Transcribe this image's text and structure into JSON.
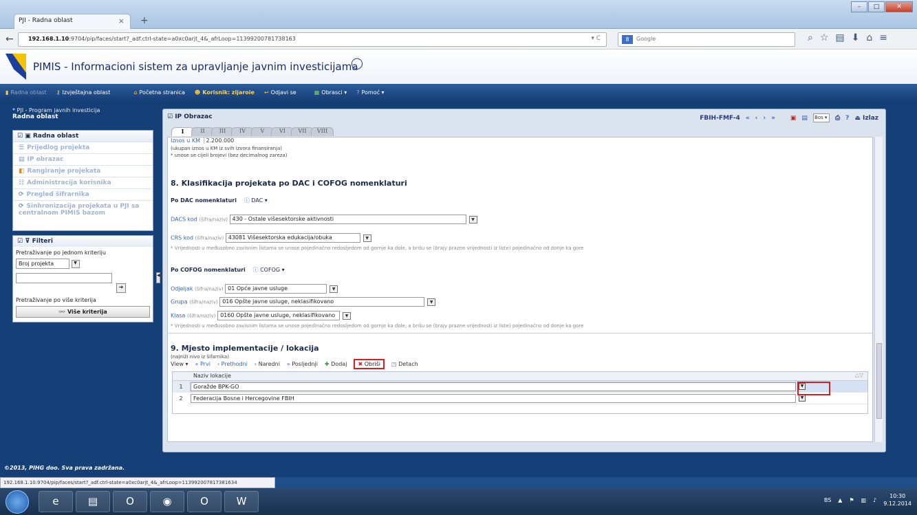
{
  "browser": {
    "tab_title": "PJI - Radna oblast",
    "url_host": "192.168.1.10",
    "url_rest": ":9704/pip/faces/start?_adf.ctrl-state=a0xc0arjt_4&_afrLoop=113992007817381​63",
    "search_placeholder": "Google",
    "search_engine_badge": "8"
  },
  "app": {
    "title": "PIMIS - Informacioni sistem za upravljanje javnim investicijama"
  },
  "menubar": {
    "radna_oblast": "Radna oblast",
    "izvjestajna": "Izvještajna oblast",
    "pocetna": "Početna stranica",
    "korisnik_label": "Korisnik:",
    "korisnik_name": "zijaroie",
    "odjavi": "Odjavi se",
    "obrasci": "Obrasci",
    "pomoc": "Pomoć"
  },
  "sidebar": {
    "crumb": "* PJI - Program javnih investicija",
    "title": "Radna oblast",
    "panel_title": "Radna oblast",
    "items": [
      {
        "label": "Prijedlog projekta"
      },
      {
        "label": "IP obrazac"
      },
      {
        "label": "Rangiranje projekata"
      },
      {
        "label": "Administracija korisnika"
      },
      {
        "label": "Pregled šifrarnika"
      },
      {
        "label": "Sinhronizacija projekata u PJI sa centralnom PIMIS bazom"
      }
    ],
    "filter_title": "Filteri",
    "filter_one": "Pretraživanje po jednom kriteriju",
    "filter_select": "Broj projekta",
    "filter_multi": "Pretraživanje po više kriterija",
    "filter_button": "Više kriterija"
  },
  "content": {
    "title": "IP Obrazac",
    "form_code": "FBIH-FMF-4",
    "lang": "Bos",
    "izlaz": "Izlaz",
    "tabs": [
      "I",
      "II",
      "III",
      "IV",
      "V",
      "VI",
      "VII",
      "VIII"
    ],
    "iznos_label": "Iznos u KM",
    "iznos_value": "2.200.000",
    "iznos_note1": "(ukupan iznos u KM iz svih izvora finansiranja)",
    "iznos_note2": "* unose se cijeli brojevi (bez decimalnog zareza)",
    "sec8_title": "8. Klasifikacija projekata po DAC i COFOG nomenklaturi",
    "dac_heading": "Po DAC nomenklaturi",
    "dac_menu": "DAC",
    "dacs_label": "DACS kod",
    "crs_label": "CRS kod",
    "sifra_naziv": "(šifra/naziv)",
    "dacs_value": "430 - Ostale višesektorske aktivnosti",
    "crs_value": "43081 Višesektorska edukacija/obuka",
    "cascade_note": "* Vrijednosti u međusobno zavisnim listama se unose pojedinačno redosljedom od gornje ka dole, a brišu se (brajy prazne vrijednosti iz liste) pojedinačno od donje ka gore",
    "cofog_heading": "Po COFOG nomenklaturi",
    "cofog_menu": "COFOG",
    "odjeljak_label": "Odjeljak",
    "grupa_label": "Grupa",
    "klasa_label": "Klasa",
    "odjeljak_value": "01 Opće javne usluge",
    "grupa_value": "016 Opšte javne usluge, neklasifikovano",
    "klasa_value": "0160 Opšte javne usluge, neklasifikovano",
    "sec9_title": "9. Mjesto implementacije / lokacija",
    "sec9_sub": "(najniži nivo iz šifarnika)",
    "tb_view": "View",
    "tb_prvi": "Prvi",
    "tb_prethodni": "Prethodni",
    "tb_naredni": "Naredni",
    "tb_posljednji": "Posljednji",
    "tb_dodaj": "Dodaj",
    "tb_obrisi": "Obriši",
    "tb_detach": "Detach",
    "grid_header": "Naziv lokacije",
    "rows": [
      {
        "n": "1",
        "value": "Goražde BPK-GO"
      },
      {
        "n": "2",
        "value": "Federacija Bosne i Hercegovine FBIH"
      }
    ]
  },
  "footer": {
    "copyright": "©2013, PIHG doo. Sva prava zadržana.",
    "status_url": "192.168.1.10:9704/pip/faces/start?_adf.ctrl-state=a0xc0arjt_4&_afrLoop=113992007817381634"
  },
  "taskbar": {
    "lang": "BS",
    "time": "10:30",
    "date": "9.12.2014"
  }
}
